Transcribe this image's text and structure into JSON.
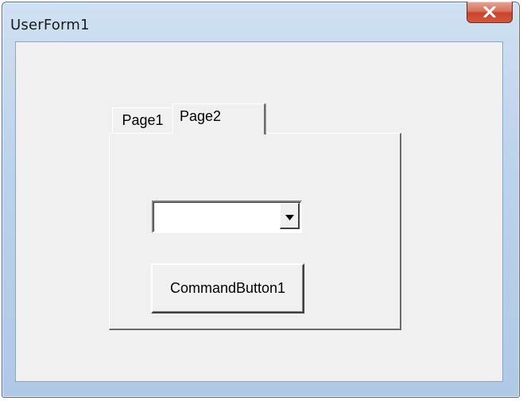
{
  "window": {
    "title": "UserForm1",
    "close_icon": "close-icon"
  },
  "multipage": {
    "tabs": [
      {
        "label": "Page1",
        "selected": false
      },
      {
        "label": "Page2",
        "selected": true
      }
    ]
  },
  "combobox": {
    "value": "",
    "dropdown_icon": "dropdown-arrow-icon"
  },
  "command_button": {
    "label": "CommandButton1"
  },
  "colors": {
    "close_button": "#c7452c",
    "form_background": "#f0f0f0",
    "frame": "#bcd3ec"
  }
}
